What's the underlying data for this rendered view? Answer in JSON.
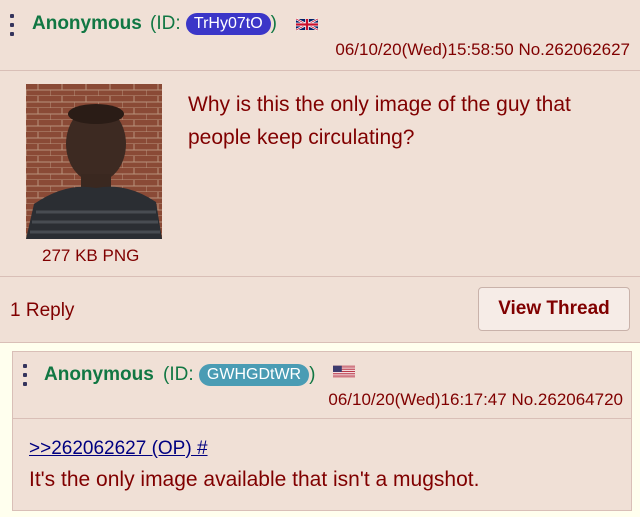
{
  "op": {
    "name": "Anonymous",
    "id_prefix": "(ID:",
    "id": "TrHy07tO",
    "id_color": "#3b36c8",
    "id_suffix": ")",
    "flag": "united-kingdom-flag",
    "datetime": "06/10/20(Wed)15:58:50",
    "post_number": "No.262062627",
    "text": "Why is this the only image of the guy that people keep circulating?",
    "file_info": "277 KB PNG",
    "replies": "1 Reply",
    "view_thread": "View Thread"
  },
  "reply": {
    "name": "Anonymous",
    "id_prefix": "(ID:",
    "id": "GWHGDtWR",
    "id_color": "#4a9cb4",
    "id_suffix": ")",
    "flag": "united-states-flag",
    "datetime": "06/10/20(Wed)16:17:47",
    "post_number": "No.262064720",
    "quote_link": ">>262062627 (OP) #",
    "text": "It's the only image available that isn't a mugshot."
  }
}
